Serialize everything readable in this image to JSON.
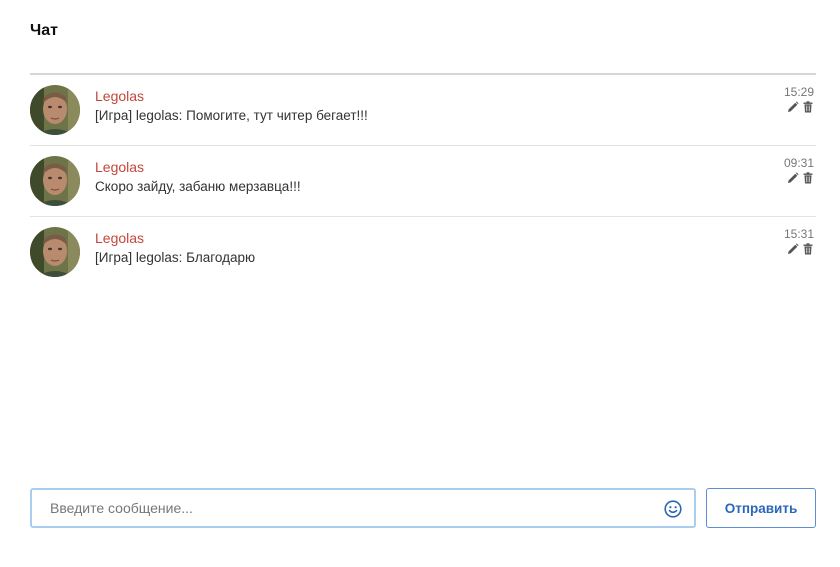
{
  "chat": {
    "title": "Чат"
  },
  "messages": [
    {
      "author": "Legolas",
      "text": "[Игра] legolas: Помогите, тут читер бегает!!!",
      "time": "15:29"
    },
    {
      "author": "Legolas",
      "text": "Скоро зайду, забаню мерзавца!!!",
      "time": "09:31"
    },
    {
      "author": "Legolas",
      "text": "[Игра] legolas: Благодарю",
      "time": "15:31"
    }
  ],
  "composer": {
    "placeholder": "Введите сообщение...",
    "value": "",
    "emoji_icon": "smiley-icon",
    "send_label": "Отправить"
  },
  "icons": {
    "edit": "pencil-icon",
    "delete": "trash-icon"
  },
  "colors": {
    "author": "#c4463c",
    "accent": "#2b66b8",
    "input_border": "#a9cdef"
  }
}
